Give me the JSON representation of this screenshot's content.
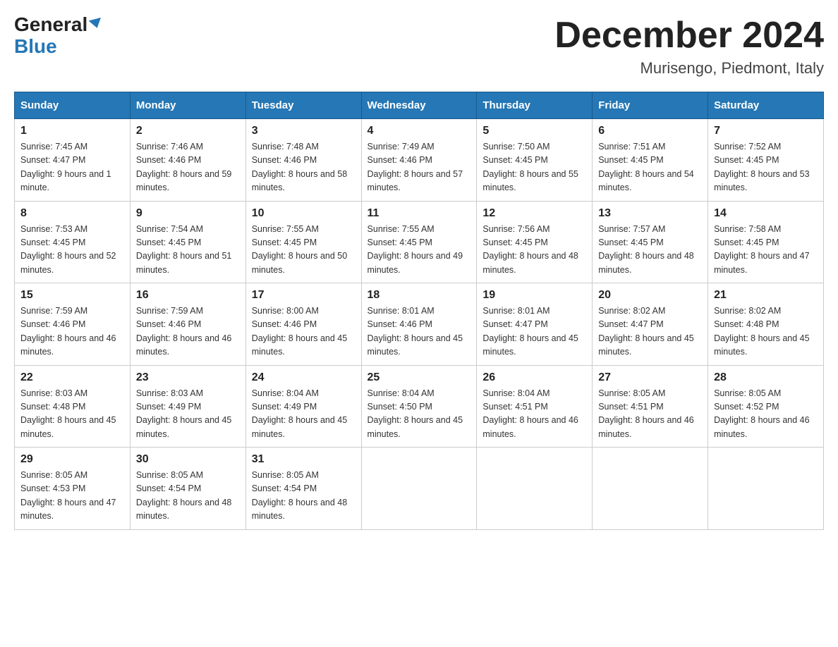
{
  "header": {
    "logo_general": "General",
    "logo_blue": "Blue",
    "month_title": "December 2024",
    "location": "Murisengo, Piedmont, Italy"
  },
  "days_of_week": [
    "Sunday",
    "Monday",
    "Tuesday",
    "Wednesday",
    "Thursday",
    "Friday",
    "Saturday"
  ],
  "weeks": [
    [
      {
        "day": "1",
        "sunrise": "Sunrise: 7:45 AM",
        "sunset": "Sunset: 4:47 PM",
        "daylight": "Daylight: 9 hours and 1 minute."
      },
      {
        "day": "2",
        "sunrise": "Sunrise: 7:46 AM",
        "sunset": "Sunset: 4:46 PM",
        "daylight": "Daylight: 8 hours and 59 minutes."
      },
      {
        "day": "3",
        "sunrise": "Sunrise: 7:48 AM",
        "sunset": "Sunset: 4:46 PM",
        "daylight": "Daylight: 8 hours and 58 minutes."
      },
      {
        "day": "4",
        "sunrise": "Sunrise: 7:49 AM",
        "sunset": "Sunset: 4:46 PM",
        "daylight": "Daylight: 8 hours and 57 minutes."
      },
      {
        "day": "5",
        "sunrise": "Sunrise: 7:50 AM",
        "sunset": "Sunset: 4:45 PM",
        "daylight": "Daylight: 8 hours and 55 minutes."
      },
      {
        "day": "6",
        "sunrise": "Sunrise: 7:51 AM",
        "sunset": "Sunset: 4:45 PM",
        "daylight": "Daylight: 8 hours and 54 minutes."
      },
      {
        "day": "7",
        "sunrise": "Sunrise: 7:52 AM",
        "sunset": "Sunset: 4:45 PM",
        "daylight": "Daylight: 8 hours and 53 minutes."
      }
    ],
    [
      {
        "day": "8",
        "sunrise": "Sunrise: 7:53 AM",
        "sunset": "Sunset: 4:45 PM",
        "daylight": "Daylight: 8 hours and 52 minutes."
      },
      {
        "day": "9",
        "sunrise": "Sunrise: 7:54 AM",
        "sunset": "Sunset: 4:45 PM",
        "daylight": "Daylight: 8 hours and 51 minutes."
      },
      {
        "day": "10",
        "sunrise": "Sunrise: 7:55 AM",
        "sunset": "Sunset: 4:45 PM",
        "daylight": "Daylight: 8 hours and 50 minutes."
      },
      {
        "day": "11",
        "sunrise": "Sunrise: 7:55 AM",
        "sunset": "Sunset: 4:45 PM",
        "daylight": "Daylight: 8 hours and 49 minutes."
      },
      {
        "day": "12",
        "sunrise": "Sunrise: 7:56 AM",
        "sunset": "Sunset: 4:45 PM",
        "daylight": "Daylight: 8 hours and 48 minutes."
      },
      {
        "day": "13",
        "sunrise": "Sunrise: 7:57 AM",
        "sunset": "Sunset: 4:45 PM",
        "daylight": "Daylight: 8 hours and 48 minutes."
      },
      {
        "day": "14",
        "sunrise": "Sunrise: 7:58 AM",
        "sunset": "Sunset: 4:45 PM",
        "daylight": "Daylight: 8 hours and 47 minutes."
      }
    ],
    [
      {
        "day": "15",
        "sunrise": "Sunrise: 7:59 AM",
        "sunset": "Sunset: 4:46 PM",
        "daylight": "Daylight: 8 hours and 46 minutes."
      },
      {
        "day": "16",
        "sunrise": "Sunrise: 7:59 AM",
        "sunset": "Sunset: 4:46 PM",
        "daylight": "Daylight: 8 hours and 46 minutes."
      },
      {
        "day": "17",
        "sunrise": "Sunrise: 8:00 AM",
        "sunset": "Sunset: 4:46 PM",
        "daylight": "Daylight: 8 hours and 45 minutes."
      },
      {
        "day": "18",
        "sunrise": "Sunrise: 8:01 AM",
        "sunset": "Sunset: 4:46 PM",
        "daylight": "Daylight: 8 hours and 45 minutes."
      },
      {
        "day": "19",
        "sunrise": "Sunrise: 8:01 AM",
        "sunset": "Sunset: 4:47 PM",
        "daylight": "Daylight: 8 hours and 45 minutes."
      },
      {
        "day": "20",
        "sunrise": "Sunrise: 8:02 AM",
        "sunset": "Sunset: 4:47 PM",
        "daylight": "Daylight: 8 hours and 45 minutes."
      },
      {
        "day": "21",
        "sunrise": "Sunrise: 8:02 AM",
        "sunset": "Sunset: 4:48 PM",
        "daylight": "Daylight: 8 hours and 45 minutes."
      }
    ],
    [
      {
        "day": "22",
        "sunrise": "Sunrise: 8:03 AM",
        "sunset": "Sunset: 4:48 PM",
        "daylight": "Daylight: 8 hours and 45 minutes."
      },
      {
        "day": "23",
        "sunrise": "Sunrise: 8:03 AM",
        "sunset": "Sunset: 4:49 PM",
        "daylight": "Daylight: 8 hours and 45 minutes."
      },
      {
        "day": "24",
        "sunrise": "Sunrise: 8:04 AM",
        "sunset": "Sunset: 4:49 PM",
        "daylight": "Daylight: 8 hours and 45 minutes."
      },
      {
        "day": "25",
        "sunrise": "Sunrise: 8:04 AM",
        "sunset": "Sunset: 4:50 PM",
        "daylight": "Daylight: 8 hours and 45 minutes."
      },
      {
        "day": "26",
        "sunrise": "Sunrise: 8:04 AM",
        "sunset": "Sunset: 4:51 PM",
        "daylight": "Daylight: 8 hours and 46 minutes."
      },
      {
        "day": "27",
        "sunrise": "Sunrise: 8:05 AM",
        "sunset": "Sunset: 4:51 PM",
        "daylight": "Daylight: 8 hours and 46 minutes."
      },
      {
        "day": "28",
        "sunrise": "Sunrise: 8:05 AM",
        "sunset": "Sunset: 4:52 PM",
        "daylight": "Daylight: 8 hours and 46 minutes."
      }
    ],
    [
      {
        "day": "29",
        "sunrise": "Sunrise: 8:05 AM",
        "sunset": "Sunset: 4:53 PM",
        "daylight": "Daylight: 8 hours and 47 minutes."
      },
      {
        "day": "30",
        "sunrise": "Sunrise: 8:05 AM",
        "sunset": "Sunset: 4:54 PM",
        "daylight": "Daylight: 8 hours and 48 minutes."
      },
      {
        "day": "31",
        "sunrise": "Sunrise: 8:05 AM",
        "sunset": "Sunset: 4:54 PM",
        "daylight": "Daylight: 8 hours and 48 minutes."
      },
      null,
      null,
      null,
      null
    ]
  ]
}
